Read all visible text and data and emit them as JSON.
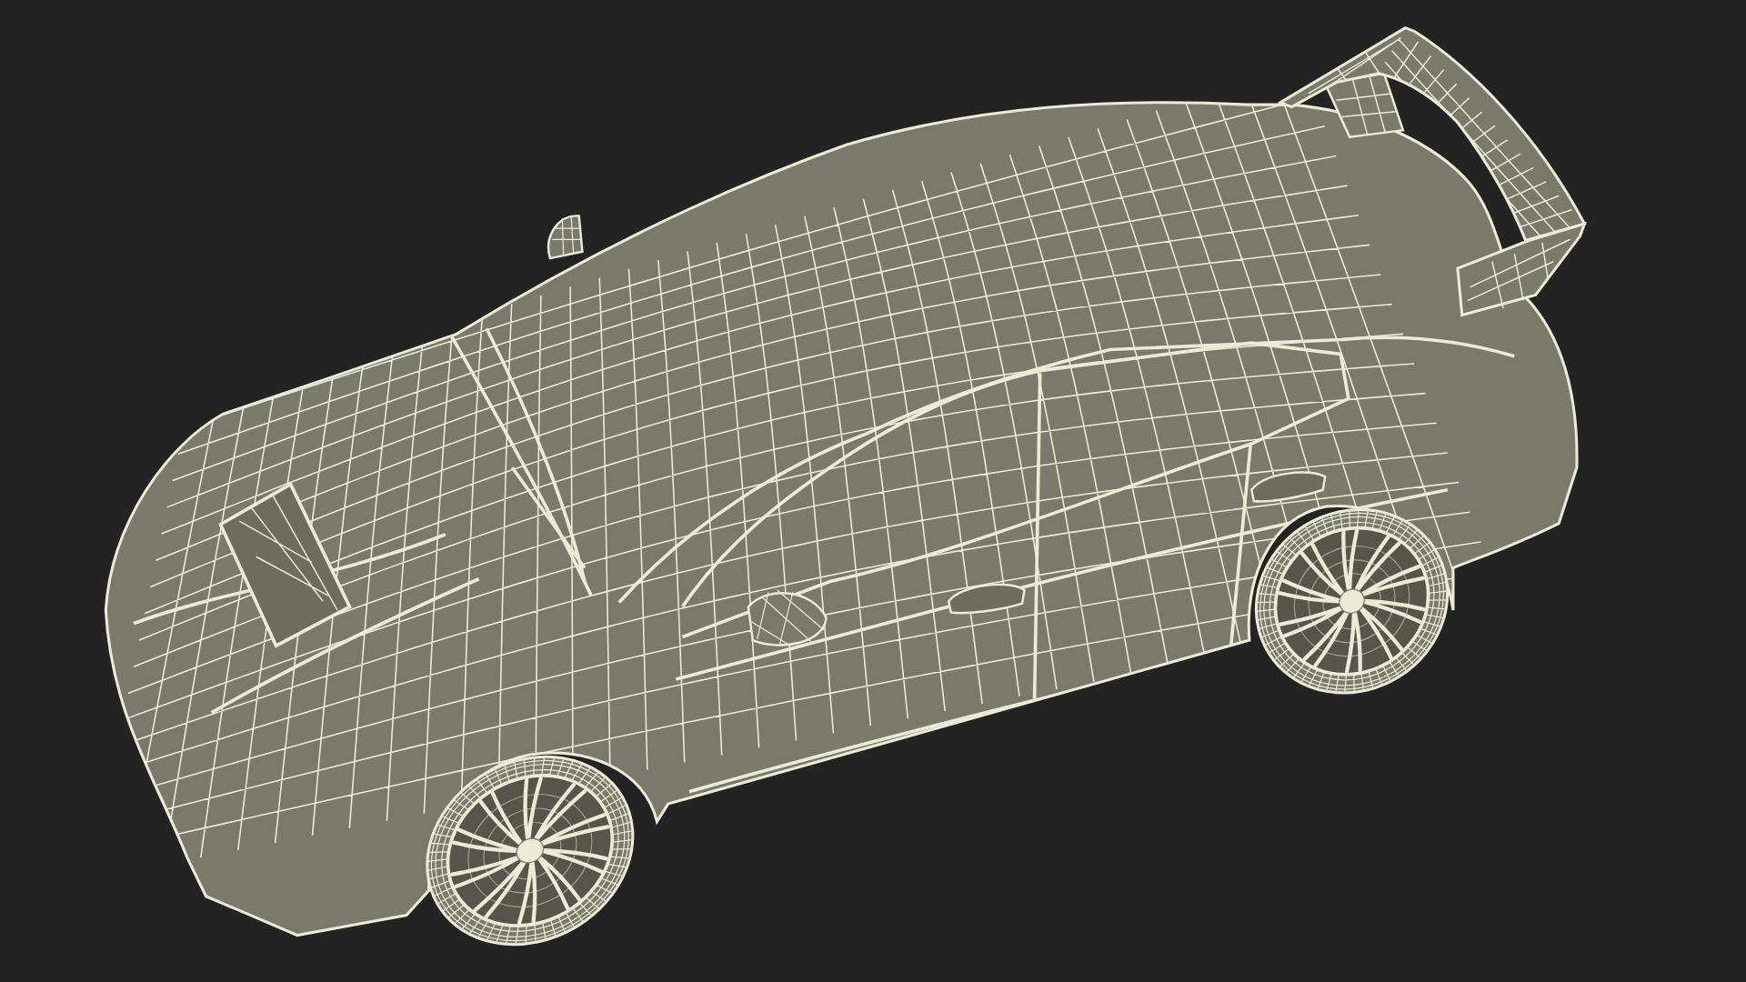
{
  "viewport": {
    "kind": "wireframe"
  }
}
